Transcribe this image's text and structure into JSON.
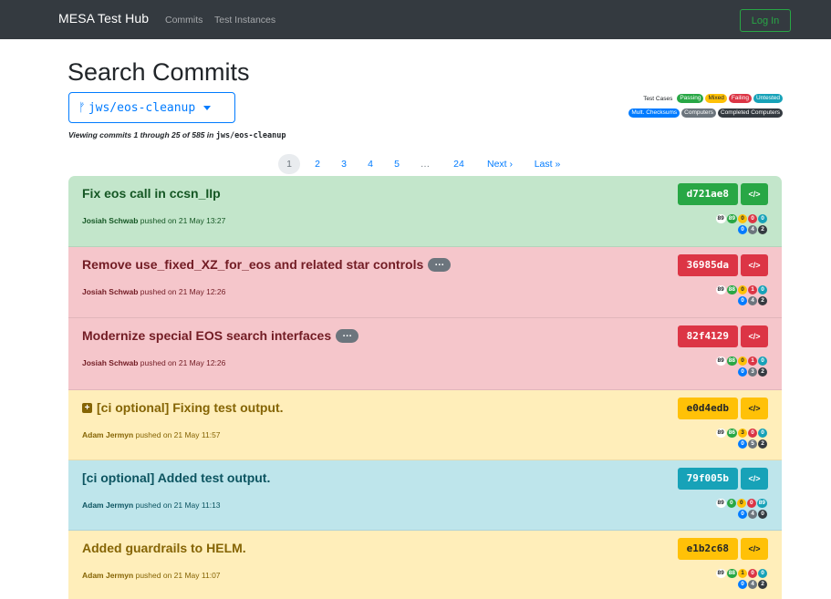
{
  "navbar": {
    "brand": "MESA Test Hub",
    "links": [
      "Commits",
      "Test Instances"
    ],
    "login": "Log In"
  },
  "page": {
    "title": "Search Commits",
    "branch": "jws/eos-cleanup",
    "viewing_prefix": "Viewing commits 1 through 25 of 585 in",
    "viewing_branch": "jws/eos-cleanup"
  },
  "legend": {
    "label": "Test Cases",
    "row1": [
      {
        "text": "Passing",
        "color": "#28a745"
      },
      {
        "text": "Mixed",
        "color": "#ffc107"
      },
      {
        "text": "Failing",
        "color": "#dc3545"
      },
      {
        "text": "Untested",
        "color": "#17a2b8"
      }
    ],
    "row2": [
      {
        "text": "Mult. Checksums",
        "color": "#007bff"
      },
      {
        "text": "Computers",
        "color": "#6c757d"
      },
      {
        "text": "Completed Computers",
        "color": "#343a40"
      }
    ]
  },
  "pagination": [
    "1",
    "2",
    "3",
    "4",
    "5",
    "…",
    "24",
    "Next ›",
    "Last »"
  ],
  "commits": [
    {
      "status": "success",
      "title": "Fix eos call in ccsn_IIp",
      "has_plus": false,
      "has_ellipsis": false,
      "author": "Josiah Schwab",
      "pushed": "pushed on 21 May 13:27",
      "sha": "d721ae8",
      "code": "</>",
      "counts": [
        "89",
        "89",
        "0",
        "0",
        "0"
      ],
      "counts2": [
        "0",
        "4",
        "2"
      ]
    },
    {
      "status": "danger",
      "title": "Remove use_fixed_XZ_for_eos and related star controls",
      "has_plus": false,
      "has_ellipsis": true,
      "ellipsis": "…",
      "author": "Josiah Schwab",
      "pushed": "pushed on 21 May 12:26",
      "sha": "36985da",
      "code": "</>",
      "counts": [
        "89",
        "88",
        "0",
        "1",
        "0"
      ],
      "counts2": [
        "0",
        "4",
        "2"
      ]
    },
    {
      "status": "danger",
      "title": "Modernize special EOS search interfaces",
      "has_plus": false,
      "has_ellipsis": true,
      "ellipsis": "…",
      "author": "Josiah Schwab",
      "pushed": "pushed on 21 May 12:26",
      "sha": "82f4129",
      "code": "</>",
      "counts": [
        "89",
        "88",
        "0",
        "1",
        "0"
      ],
      "counts2": [
        "0",
        "3",
        "2"
      ]
    },
    {
      "status": "warning",
      "title": "[ci optional] Fixing test output.",
      "has_plus": true,
      "plus": "+",
      "has_ellipsis": false,
      "author": "Adam Jermyn",
      "pushed": "pushed on 21 May 11:57",
      "sha": "e0d4edb",
      "code": "</>",
      "counts": [
        "89",
        "86",
        "3",
        "0",
        "0"
      ],
      "counts2": [
        "0",
        "5",
        "2"
      ]
    },
    {
      "status": "info",
      "title": "[ci optional] Added test output.",
      "has_plus": false,
      "has_ellipsis": false,
      "author": "Adam Jermyn",
      "pushed": "pushed on 21 May 11:13",
      "sha": "79f005b",
      "code": "</>",
      "counts": [
        "89",
        "0",
        "0",
        "0",
        "89"
      ],
      "counts2": [
        "0",
        "4",
        "0"
      ]
    },
    {
      "status": "warning",
      "title": "Added guardrails to HELM.",
      "has_plus": false,
      "has_ellipsis": false,
      "author": "Adam Jermyn",
      "pushed": "pushed on 21 May 11:07",
      "sha": "e1b2c68",
      "code": "</>",
      "counts": [
        "89",
        "88",
        "1",
        "0",
        "0"
      ],
      "counts2": [
        "0",
        "4",
        "2"
      ]
    }
  ]
}
